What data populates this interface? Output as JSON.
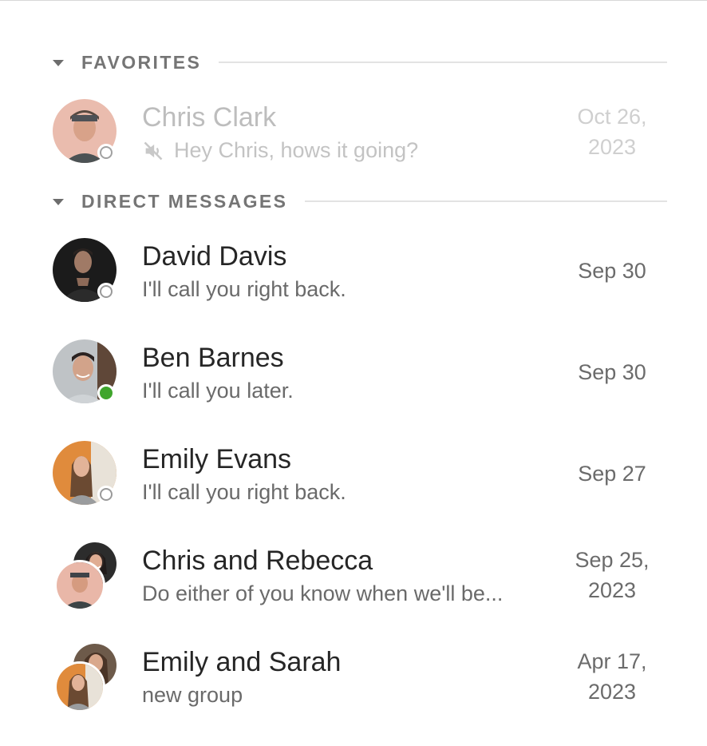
{
  "sections": {
    "favorites": {
      "title": "FAVORITES"
    },
    "direct": {
      "title": "DIRECT MESSAGES"
    }
  },
  "favorites": [
    {
      "name": "Chris Clark",
      "preview": "Hey Chris, hows it going?",
      "date_line1": "Oct 26,",
      "date_line2": "2023",
      "presence": "offline",
      "muted": true
    }
  ],
  "direct_messages": [
    {
      "name": "David Davis",
      "preview": "I'll call you right back.",
      "date_line1": "Sep 30",
      "date_line2": "",
      "presence": "offline"
    },
    {
      "name": "Ben Barnes",
      "preview": "I'll call you later.",
      "date_line1": "Sep 30",
      "date_line2": "",
      "presence": "online"
    },
    {
      "name": "Emily Evans",
      "preview": "I'll call you right back.",
      "date_line1": "Sep 27",
      "date_line2": "",
      "presence": "offline"
    },
    {
      "name": "Chris and Rebecca",
      "preview": "Do either of you know when we'll be...",
      "date_line1": "Sep 25,",
      "date_line2": "2023",
      "presence": "group"
    },
    {
      "name": "Emily and Sarah",
      "preview": "new group",
      "date_line1": "Apr 17,",
      "date_line2": "2023",
      "presence": "group"
    }
  ],
  "colors": {
    "online": "#3fa52c",
    "offline_ring": "#9a9a9a",
    "muted_text": "#c3c3c3"
  },
  "icons": {
    "caret": "caret-down-icon",
    "mute": "mute-icon"
  }
}
